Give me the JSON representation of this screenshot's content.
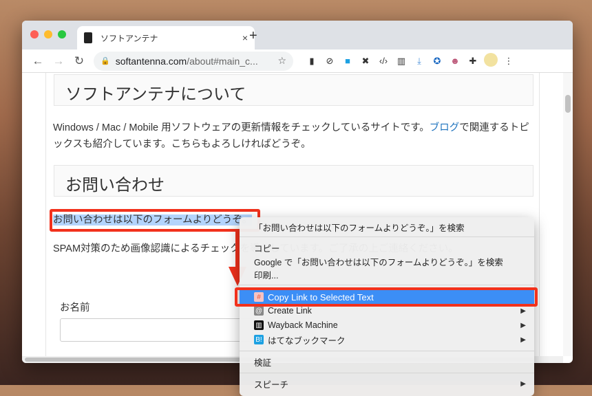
{
  "browser": {
    "tab_title": "ソフトアンテナ",
    "tab_close": "×",
    "new_tab": "+",
    "url_host": "softantenna.com",
    "url_path": "/about#main_c...",
    "back": "←",
    "forward": "→",
    "reload": "↻",
    "star": "☆",
    "menu": "⋮"
  },
  "extensions": [
    "create-link-icon",
    "block-icon",
    "hatena-icon",
    "pin-icon",
    "code-icon",
    "wayback-icon",
    "download-icon",
    "network-icon",
    "avatar-ext-icon",
    "puzzle-icon"
  ],
  "page": {
    "heading1": "ソフトアンテナについて",
    "para1_before": "Windows / Mac / Mobile 用ソフトウェアの更新情報をチェックしているサイトです。",
    "para1_link": "ブログ",
    "para1_after": "で関連するトピックスも紹介しています。こちらもよろしければどうぞ。",
    "heading2": "お問い合わせ",
    "selected_text": "お問い合わせは以下のフォームよりどうぞ。",
    "para2": "SPAM対策のため画像認識によるチェックを導入しています。ご了承の上ご連絡ください。",
    "name_label": "お名前"
  },
  "context_menu": {
    "search": "「お問い合わせは以下のフォームよりどうぞ。」を検索",
    "copy": "コピー",
    "google": "Google で「お問い合わせは以下のフォームよりどうぞ。」を検索",
    "print": "印刷...",
    "copy_link": "Copy Link to Selected Text",
    "create_link": "Create Link",
    "wayback": "Wayback Machine",
    "hatena": "はてなブックマーク",
    "inspect": "検証",
    "speech": "スピーチ",
    "submenu_arrow": "▶"
  },
  "colors": {
    "highlight": "#3c8ef6",
    "annotation": "#f2311c",
    "link": "#1e73be"
  }
}
